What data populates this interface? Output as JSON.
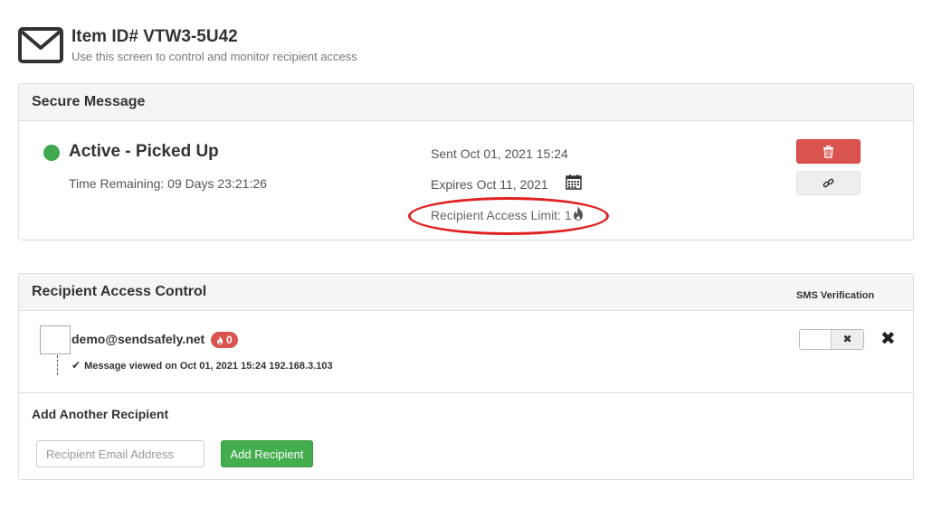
{
  "header": {
    "title": "Item ID# VTW3-5U42",
    "subtitle": "Use this screen to control and monitor recipient access",
    "icon": "envelope-icon"
  },
  "secure_message": {
    "title": "Secure Message",
    "status": "Active - Picked Up",
    "status_color": "#3fa84e",
    "time_remaining": "Time Remaining: 09 Days 23:21:26",
    "sent": "Sent Oct 01, 2021 15:24",
    "expires": "Expires Oct 11, 2021",
    "access_limit": "Recipient Access Limit: 1",
    "delete_icon": "trash-icon",
    "link_icon": "link-icon",
    "danger_color": "#d9534f"
  },
  "recipient_access": {
    "title": "Recipient Access Control",
    "sms_header": "SMS Verification",
    "recipients": [
      {
        "email": "demo@sendsafely.net",
        "access_count": "0",
        "activity": "Message viewed on Oct 01, 2021 15:24 192.168.3.103",
        "sms_toggle_label": "✖"
      }
    ],
    "remove_icon": "close-icon"
  },
  "add_recipient": {
    "title": "Add Another Recipient",
    "placeholder": "Recipient Email Address",
    "button_label": "Add Recipient",
    "button_color": "#44ad4e"
  }
}
